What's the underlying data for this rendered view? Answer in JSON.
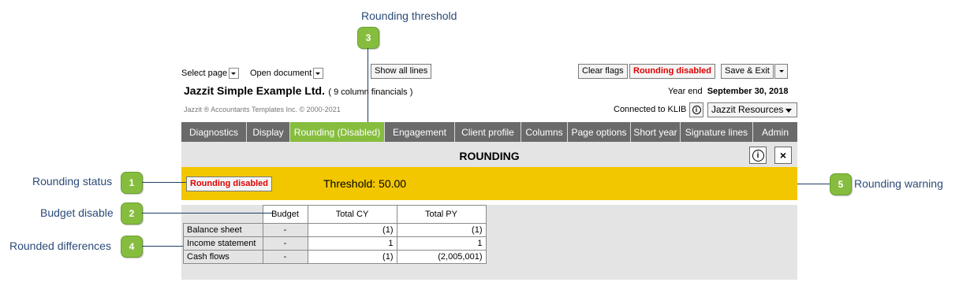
{
  "callouts": {
    "rounding_threshold": "Rounding threshold",
    "rounding_status": "Rounding status",
    "budget_disable": "Budget disable",
    "rounded_differences": "Rounded differences",
    "rounding_warning": "Rounding warning",
    "badge_1": "1",
    "badge_2": "2",
    "badge_3": "3",
    "badge_4": "4",
    "badge_5": "5"
  },
  "toolbar": {
    "select_page": "Select page",
    "open_document": "Open document",
    "show_all_lines": "Show all lines",
    "clear_flags": "Clear flags",
    "rounding_disabled": "Rounding disabled",
    "save_exit": "Save & Exit"
  },
  "header": {
    "company": "Jazzit Simple Example Ltd.",
    "subtitle": "( 9 column financials )",
    "year_end_label": "Year end",
    "year_end_value": "September 30, 2018",
    "copyright": "Jazzit ® Accountants Templates Inc. © 2000-2021",
    "connected": "Connected to KLIB",
    "resources": "Jazzit Resources"
  },
  "tabs": [
    "Diagnostics",
    "Display",
    "Rounding (Disabled)",
    "Engagement",
    "Client profile",
    "Columns",
    "Page options",
    "Short year",
    "Signature lines",
    "Admin"
  ],
  "panel": {
    "title": "ROUNDING",
    "status_button": "Rounding disabled",
    "threshold": "Threshold: 50.00"
  },
  "table": {
    "headers": [
      "",
      "Budget",
      "Total CY",
      "Total PY"
    ],
    "rows": [
      [
        "Balance sheet",
        "-",
        "(1)",
        "(1)"
      ],
      [
        "Income statement",
        "-",
        "1",
        "1"
      ],
      [
        "Cash flows",
        "-",
        "(1)",
        "(2,005,001)"
      ]
    ]
  },
  "colors": {
    "accent_green": "#86bd3e",
    "warning_yellow": "#f2c700",
    "tab_grey": "#6a6a6a",
    "callout_blue": "#2b4a78"
  },
  "icons": [
    "info-icon",
    "close-icon",
    "chevron-down-icon"
  ]
}
